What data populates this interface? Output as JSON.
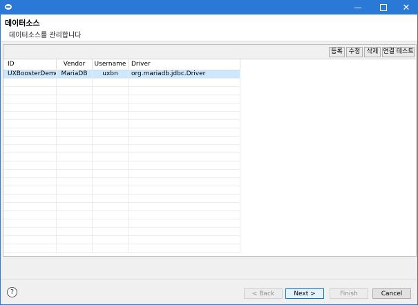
{
  "window": {
    "controls": {
      "close_glyph": "✕"
    }
  },
  "header": {
    "title": "데이터소스",
    "description": "데이터소스를 관리합니다"
  },
  "toolbar": {
    "register": "등록",
    "edit": "수정",
    "delete": "삭제",
    "test": "연결 테스트"
  },
  "table": {
    "columns": [
      "ID",
      "Vendor",
      "Username",
      "Driver"
    ],
    "rows": [
      [
        "UXBoosterDemo",
        "MariaDB",
        "uxbn",
        "org.mariadb.jdbc.Driver"
      ]
    ],
    "selected_row": 0
  },
  "footer": {
    "help_glyph": "?",
    "back": "< Back",
    "next": "Next >",
    "finish": "Finish",
    "cancel": "Cancel"
  }
}
